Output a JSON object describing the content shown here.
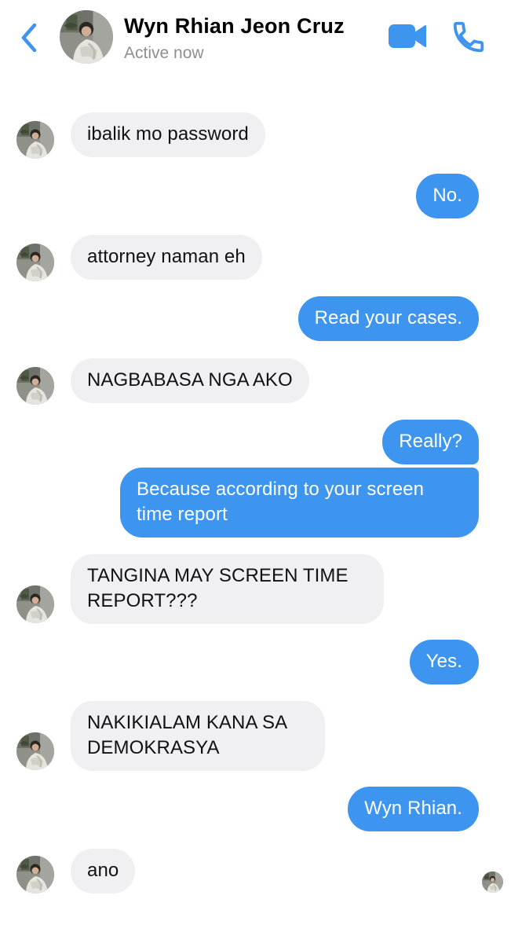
{
  "header": {
    "contact_name": "Wyn Rhian Jeon Cruz",
    "status": "Active now",
    "back_icon": "chevron-left-icon",
    "video_icon": "video-camera-icon",
    "phone_icon": "phone-icon",
    "accent_color": "#3d95ef"
  },
  "messages": [
    {
      "from": "contact",
      "text": "ibalik mo password"
    },
    {
      "from": "me",
      "text": "No."
    },
    {
      "from": "contact",
      "text": "attorney naman eh"
    },
    {
      "from": "me",
      "text": "Read your cases."
    },
    {
      "from": "contact",
      "text": "NAGBABASA NGA AKO"
    },
    {
      "from": "me",
      "text": "Really?"
    },
    {
      "from": "me",
      "text": "Because according to your screen time report"
    },
    {
      "from": "contact",
      "text": "TANGINA MAY SCREEN TIME REPORT???"
    },
    {
      "from": "me",
      "text": "Yes."
    },
    {
      "from": "contact",
      "text": "NAKIKIALAM KANA SA DEMOKRASYA"
    },
    {
      "from": "me",
      "text": "Wyn Rhian."
    },
    {
      "from": "contact",
      "text": "ano"
    }
  ],
  "colors": {
    "incoming_bubble": "#f0f0f3",
    "outgoing_bubble": "#3d95ef",
    "status_text": "#8e8e93"
  }
}
